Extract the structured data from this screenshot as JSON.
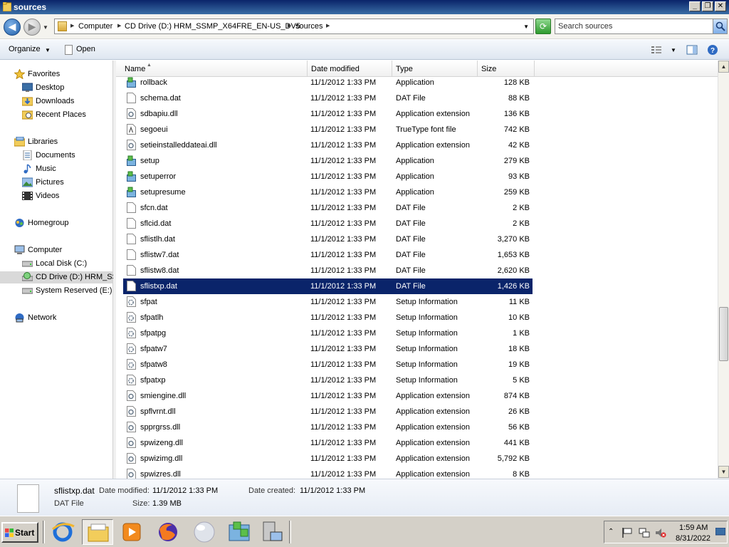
{
  "window": {
    "title": "sources",
    "min_glyph": "_",
    "max_glyph": "❐",
    "close_glyph": "✕"
  },
  "address": {
    "crumbs": [
      "Computer",
      "CD Drive (D:) HRM_SSMP_X64FRE_EN-US_DV5",
      "sources"
    ]
  },
  "search": {
    "placeholder": "Search sources"
  },
  "toolbar": {
    "organize_label": "Organize",
    "open_label": "Open"
  },
  "nav": {
    "favorites": "Favorites",
    "desktop": "Desktop",
    "downloads": "Downloads",
    "recent": "Recent Places",
    "libraries": "Libraries",
    "documents": "Documents",
    "music": "Music",
    "pictures": "Pictures",
    "videos": "Videos",
    "homegroup": "Homegroup",
    "computer": "Computer",
    "local_disk": "Local Disk (C:)",
    "cd_drive": "CD Drive (D:) HRM_SS",
    "system_reserved": "System Reserved (E:)",
    "network": "Network"
  },
  "columns": {
    "name": "Name",
    "date": "Date modified",
    "type": "Type",
    "size": "Size"
  },
  "files": [
    {
      "name": "rollback",
      "date": "11/1/2012 1:33 PM",
      "type": "Application",
      "size": "128 KB",
      "icon": "app"
    },
    {
      "name": "schema.dat",
      "date": "11/1/2012 1:33 PM",
      "type": "DAT File",
      "size": "88 KB",
      "icon": "file"
    },
    {
      "name": "sdbapiu.dll",
      "date": "11/1/2012 1:33 PM",
      "type": "Application extension",
      "size": "136 KB",
      "icon": "dll"
    },
    {
      "name": "segoeui",
      "date": "11/1/2012 1:33 PM",
      "type": "TrueType font file",
      "size": "742 KB",
      "icon": "font"
    },
    {
      "name": "setieinstalleddateai.dll",
      "date": "11/1/2012 1:33 PM",
      "type": "Application extension",
      "size": "42 KB",
      "icon": "dll"
    },
    {
      "name": "setup",
      "date": "11/1/2012 1:33 PM",
      "type": "Application",
      "size": "279 KB",
      "icon": "app"
    },
    {
      "name": "setuperror",
      "date": "11/1/2012 1:33 PM",
      "type": "Application",
      "size": "93 KB",
      "icon": "app"
    },
    {
      "name": "setupresume",
      "date": "11/1/2012 1:33 PM",
      "type": "Application",
      "size": "259 KB",
      "icon": "app"
    },
    {
      "name": "sfcn.dat",
      "date": "11/1/2012 1:33 PM",
      "type": "DAT File",
      "size": "2 KB",
      "icon": "file"
    },
    {
      "name": "sflcid.dat",
      "date": "11/1/2012 1:33 PM",
      "type": "DAT File",
      "size": "2 KB",
      "icon": "file"
    },
    {
      "name": "sflistlh.dat",
      "date": "11/1/2012 1:33 PM",
      "type": "DAT File",
      "size": "3,270 KB",
      "icon": "file"
    },
    {
      "name": "sflistw7.dat",
      "date": "11/1/2012 1:33 PM",
      "type": "DAT File",
      "size": "1,653 KB",
      "icon": "file"
    },
    {
      "name": "sflistw8.dat",
      "date": "11/1/2012 1:33 PM",
      "type": "DAT File",
      "size": "2,620 KB",
      "icon": "file"
    },
    {
      "name": "sflistxp.dat",
      "date": "11/1/2012 1:33 PM",
      "type": "DAT File",
      "size": "1,426 KB",
      "icon": "file",
      "selected": true
    },
    {
      "name": "sfpat",
      "date": "11/1/2012 1:33 PM",
      "type": "Setup Information",
      "size": "11 KB",
      "icon": "inf"
    },
    {
      "name": "sfpatlh",
      "date": "11/1/2012 1:33 PM",
      "type": "Setup Information",
      "size": "10 KB",
      "icon": "inf"
    },
    {
      "name": "sfpatpg",
      "date": "11/1/2012 1:33 PM",
      "type": "Setup Information",
      "size": "1 KB",
      "icon": "inf"
    },
    {
      "name": "sfpatw7",
      "date": "11/1/2012 1:33 PM",
      "type": "Setup Information",
      "size": "18 KB",
      "icon": "inf"
    },
    {
      "name": "sfpatw8",
      "date": "11/1/2012 1:33 PM",
      "type": "Setup Information",
      "size": "19 KB",
      "icon": "inf"
    },
    {
      "name": "sfpatxp",
      "date": "11/1/2012 1:33 PM",
      "type": "Setup Information",
      "size": "5 KB",
      "icon": "inf"
    },
    {
      "name": "smiengine.dll",
      "date": "11/1/2012 1:33 PM",
      "type": "Application extension",
      "size": "874 KB",
      "icon": "dll"
    },
    {
      "name": "spflvrnt.dll",
      "date": "11/1/2012 1:33 PM",
      "type": "Application extension",
      "size": "26 KB",
      "icon": "dll"
    },
    {
      "name": "spprgrss.dll",
      "date": "11/1/2012 1:33 PM",
      "type": "Application extension",
      "size": "56 KB",
      "icon": "dll"
    },
    {
      "name": "spwizeng.dll",
      "date": "11/1/2012 1:33 PM",
      "type": "Application extension",
      "size": "441 KB",
      "icon": "dll"
    },
    {
      "name": "spwizimg.dll",
      "date": "11/1/2012 1:33 PM",
      "type": "Application extension",
      "size": "5,792 KB",
      "icon": "dll"
    },
    {
      "name": "spwizres.dll",
      "date": "11/1/2012 1:33 PM",
      "type": "Application extension",
      "size": "8 KB",
      "icon": "dll"
    }
  ],
  "details": {
    "filename": "sflistxp.dat",
    "modified_label": "Date modified:",
    "modified_value": "11/1/2012 1:33 PM",
    "created_label": "Date created:",
    "created_value": "11/1/2012 1:33 PM",
    "type": "DAT File",
    "size_label": "Size:",
    "size_value": "1.39 MB"
  },
  "taskbar": {
    "start_label": "Start",
    "time": "1:59 AM",
    "date": "8/31/2022"
  },
  "colors": {
    "selection": "#0a246a",
    "titlebar": "#0a246a",
    "taskbar": "#d4d0c8"
  }
}
